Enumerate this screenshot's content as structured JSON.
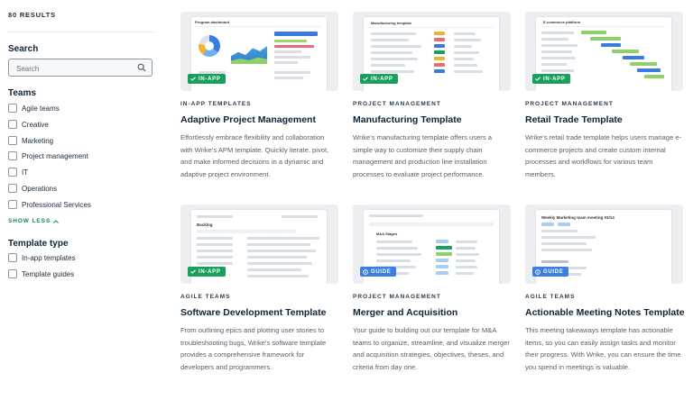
{
  "results_count": "80 RESULTS",
  "sidebar": {
    "search_heading": "Search",
    "search_placeholder": "Search",
    "teams_heading": "Teams",
    "teams": [
      "Agile teams",
      "Creative",
      "Marketing",
      "Project management",
      "IT",
      "Operations",
      "Professional Services"
    ],
    "show_less": "SHOW LESS",
    "template_type_heading": "Template type",
    "template_types": [
      "In-app templates",
      "Template guides"
    ]
  },
  "cards": [
    {
      "category": "IN-APP TEMPLATES",
      "title": "Adaptive Project Management",
      "badge": "IN-APP",
      "description": "Effortlessly embrace flexibility and collaboration with Wrike's APM template. Quickly iterate, pivot, and make informed decisions in a dynamic and adaptive project environment.",
      "thumb_title": "Program dashboard"
    },
    {
      "category": "PROJECT MANAGEMENT",
      "title": "Manufacturing Template",
      "badge": "IN-APP",
      "description": "Wrike's manufacturing template offers users a simple way to customize their supply chain management and production line installation processes to evaluate project performance.",
      "thumb_title": "Manufacturing template"
    },
    {
      "category": "PROJECT MANAGEMENT",
      "title": "Retail Trade Template",
      "badge": "IN-APP",
      "description": "Wrike's retail trade template helps users manage e-commerce projects and create custom internal processes and workflows for various team members.",
      "thumb_title": "E-commerce platform"
    },
    {
      "category": "AGILE TEAMS",
      "title": "Software Development Template",
      "badge": "IN-APP",
      "description": "From outlining epics and plotting user stories to troubleshooting bugs, Wrike's software template provides a comprehensive framework for developers and programmers.",
      "thumb_title": "Backlog"
    },
    {
      "category": "PROJECT MANAGEMENT",
      "title": "Merger and Acquisition",
      "badge": "GUIDE",
      "description": "Your guide to building out our template for M&A teams to organize, streamline, and visualize merger and acquisition strategies, objectives, theses, and criteria from day one.",
      "thumb_title": "M&A Stages"
    },
    {
      "category": "AGILE TEAMS",
      "title": "Actionable Meeting Notes Template",
      "badge": "GUIDE",
      "description": "This meeting takeaways template has actionable items, so you can easily assign tasks and monitor their progress. With Wrike, you can ensure the time you spend in meetings is valuable.",
      "thumb_title": "Weekly Marketing team meeting 03/14"
    }
  ],
  "colors": {
    "accent_green": "#18a05c",
    "guide_blue": "#3c7fe0",
    "show_less_green": "#0f8b5f",
    "heading": "#0f2337",
    "body_text": "#55616d"
  }
}
